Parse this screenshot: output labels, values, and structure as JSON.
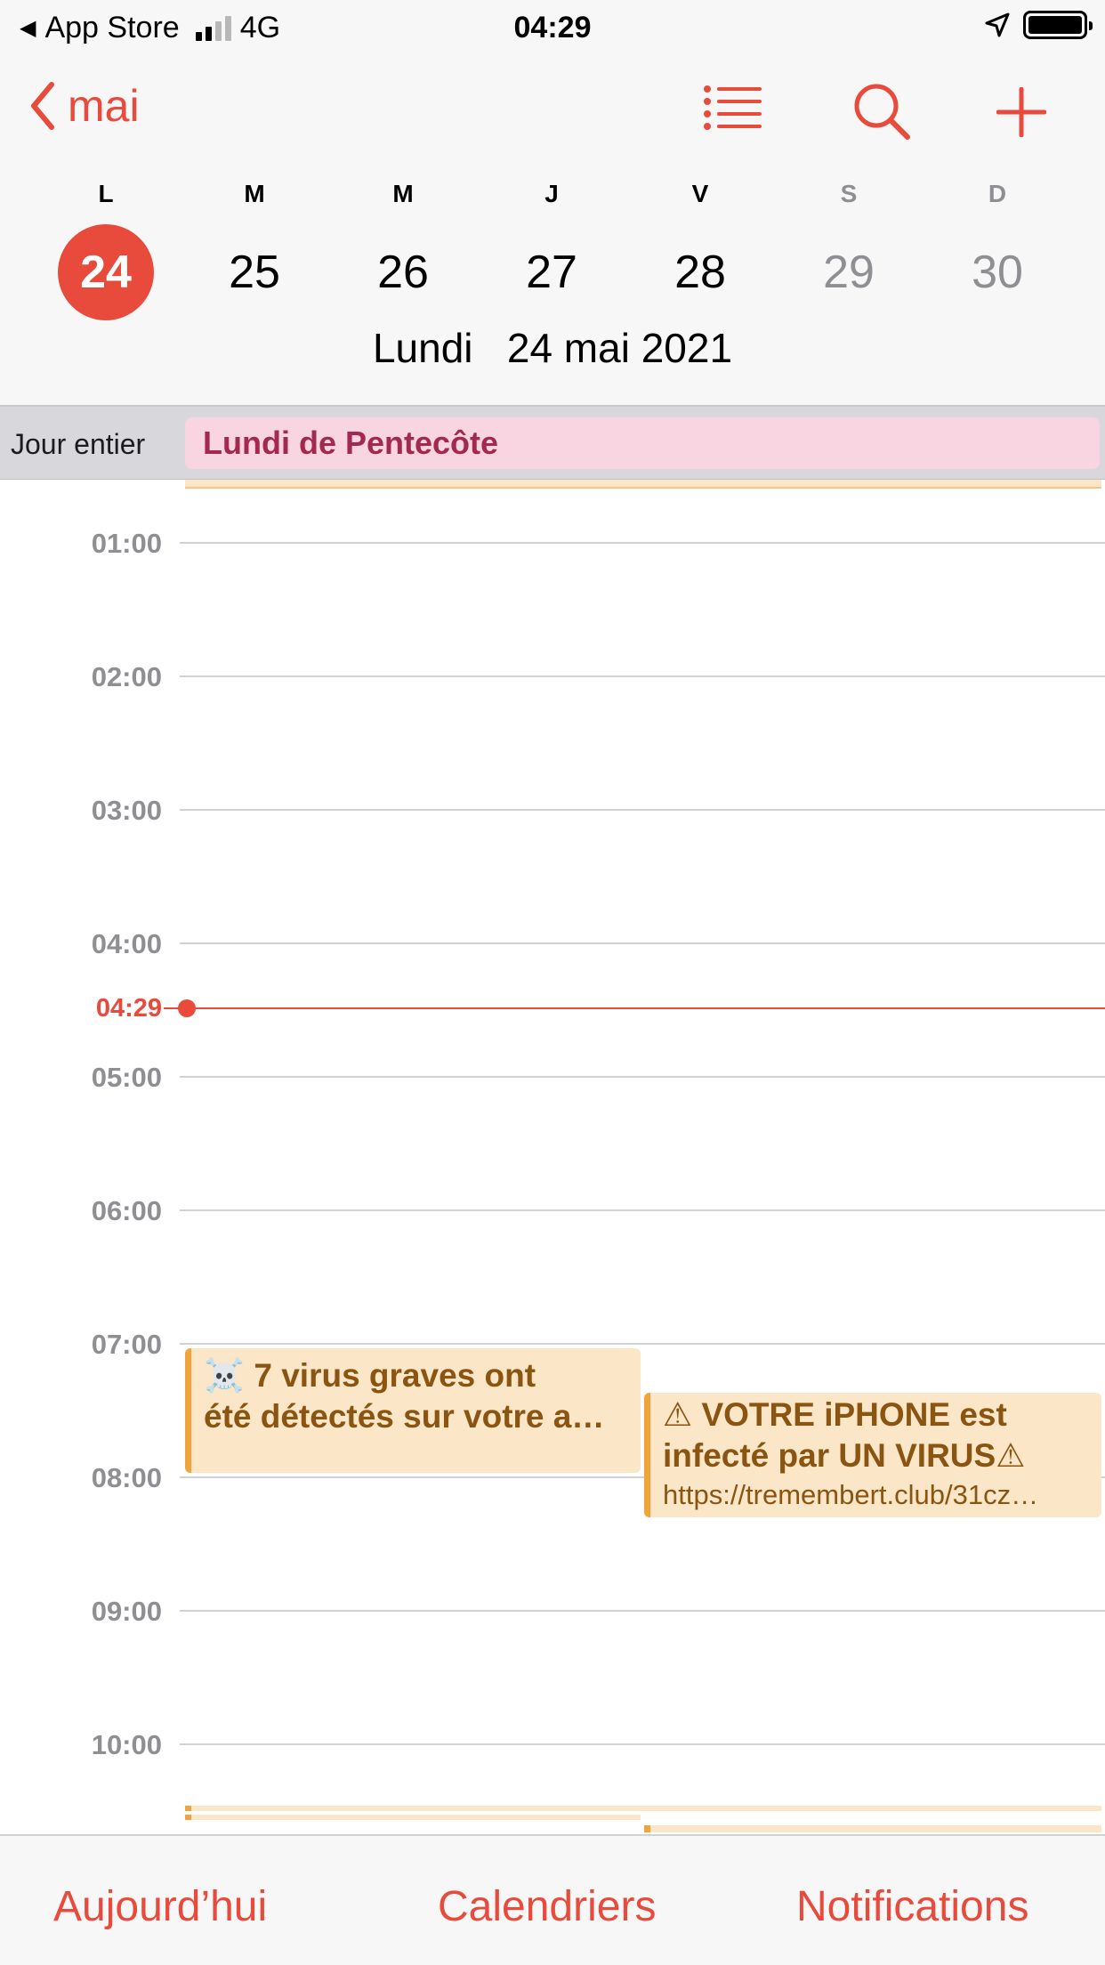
{
  "status_bar": {
    "back_app": "App Store",
    "network": "4G",
    "time": "04:29",
    "back_icon": "back-triangle-icon",
    "location_icon": "location-arrow-icon",
    "battery_icon": "battery-icon"
  },
  "header": {
    "back_label": "mai",
    "icons": [
      "list-icon",
      "search-icon",
      "plus-icon"
    ],
    "weekdays": [
      "L",
      "M",
      "M",
      "J",
      "V",
      "S",
      "D"
    ],
    "dates": [
      "24",
      "25",
      "26",
      "27",
      "28",
      "29",
      "30"
    ],
    "selected_index": 0,
    "day_name": "Lundi",
    "full_date": "24 mai 2021"
  },
  "all_day": {
    "label": "Jour entier",
    "event": "Lundi de Pentecôte"
  },
  "timeline": {
    "hours": [
      "01:00",
      "02:00",
      "03:00",
      "04:00",
      "05:00",
      "06:00",
      "07:00",
      "08:00",
      "09:00",
      "10:00"
    ],
    "now": "04:29",
    "events": [
      {
        "title_line1": "☠️      7 virus graves ont",
        "title_line2": "été détectés sur votre a…"
      },
      {
        "title_line1": "⚠ VOTRE iPHONE est",
        "title_line2": "infecté par UN VIRUS⚠",
        "url": "https://tremembert.club/31cz…"
      }
    ]
  },
  "colors": {
    "accent": "#e84a3b",
    "event_bg": "#fbe6c8",
    "event_bar": "#f2a33a",
    "event_text": "#8a5411",
    "allday_event_bg": "#f8d5e0",
    "allday_event_text": "#a2294f"
  },
  "toolbar": {
    "today": "Aujourd’hui",
    "calendars": "Calendriers",
    "notifications": "Notifications"
  }
}
